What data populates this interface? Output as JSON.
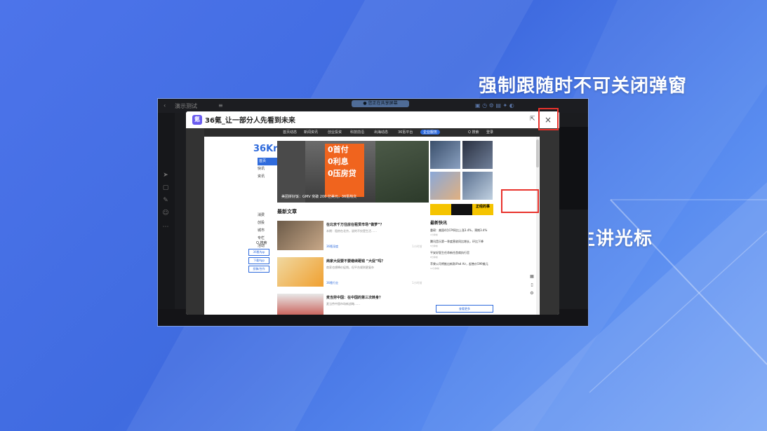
{
  "captions": {
    "top": "强制跟随时不可关闭弹窗",
    "right": "看到主讲光标"
  },
  "app": {
    "title": "演示测试",
    "share_status": "● 您正在共享屏幕",
    "tools": [
      "pointer-icon",
      "note-icon",
      "pen-icon",
      "emoji-icon",
      "more-icon"
    ]
  },
  "popup": {
    "title": "36氪_让一部分人先看到未来",
    "close_symbol": "×",
    "open_external_symbol": "⇱"
  },
  "site": {
    "nav": [
      "首页动态",
      "新闻资讯",
      "创业投资",
      "科技前沿",
      "出海动态",
      "36氪平台",
      "企业服务",
      "Q 搜索",
      "登录"
    ],
    "nav_active_index": 6,
    "logo": "36Kr",
    "menu": [
      "首页",
      "快讯",
      "资讯",
      "推荐",
      "财经",
      "科技",
      "汽车",
      "消费",
      "创投",
      "城市",
      "专栏",
      "活动"
    ],
    "menu_selected_index": 0,
    "search": "Q 搜索",
    "side_buttons": [
      "36氪App",
      "下载App",
      "投稿/合作"
    ],
    "hero": {
      "sign": [
        "0首付",
        "0利息",
        "0压房贷"
      ],
      "caption": "美团拼好饭：GMV 突破 200 亿美元，36氪热文"
    },
    "ad_strip": "正经的事",
    "section_title": "最新文章",
    "articles": [
      {
        "title": "在北京千万住房在租赁市场“做梦”？",
        "desc": "本期：租房在北京，说的不仅是生活……",
        "tag": "36氪深度",
        "time": "1小时前"
      },
      {
        "title": "商家大促要不要继续砸钱 “大促”吗？",
        "desc": "商家也想降价促销，但平台规则更复杂",
        "tag": "36氪行业",
        "time": "1小时前"
      },
      {
        "title": "麦当劳中国：在中国的第三次转身？",
        "desc": "麦当劳中国市场新战略……",
        "tag": "",
        "time": ""
      }
    ],
    "flash": {
      "header": "最新快讯",
      "items": [
        {
          "text": "重磅：美国4月CPI同比上涨3.4%，预期3.4%",
          "time": "1分钟前"
        },
        {
          "text": "腾讯音乐第一季度营收同比增长，环比下降",
          "time": "5分钟前"
        },
        {
          "text": "平安好医生任命新任首席执行官",
          "time": "8分钟前"
        },
        {
          "text": "苹果公司将推出新款iPad Air，起售价599美元",
          "time": "12分钟前"
        }
      ],
      "more": "查看更多"
    }
  }
}
